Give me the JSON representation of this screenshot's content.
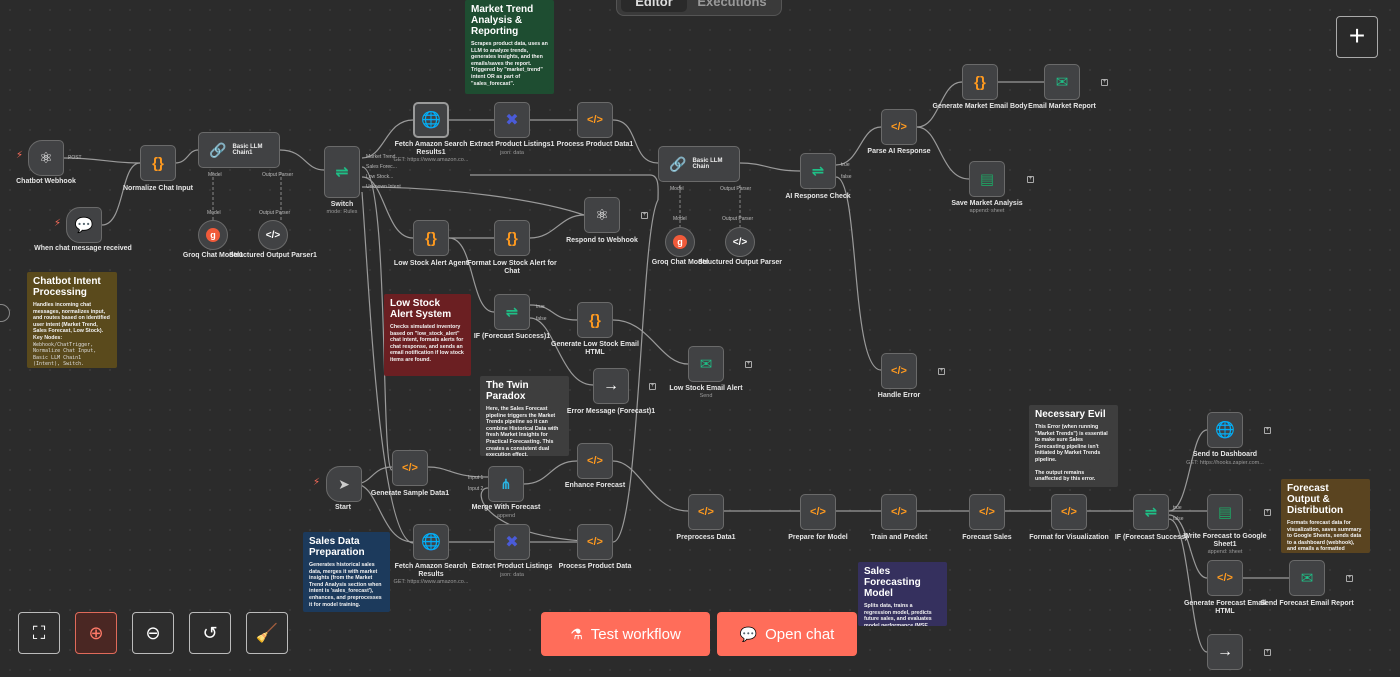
{
  "header": {
    "tabs": [
      "Editor",
      "Executions"
    ],
    "add_button": "+"
  },
  "colors": {
    "accent": "#ff6d5a",
    "canvas": "#2b2b2b",
    "node": "#414244"
  },
  "notes": [
    {
      "title": "Market Trend Analysis & Reporting",
      "body": "Scrapes product data, uses an LLM to analyze trends, generates insights, and then emails/saves the report. Triggered by \"market_trend\" intent OR as part of \"sales_forecast\".",
      "body2": "",
      "mono": ""
    },
    {
      "title": "Chatbot Intent Processing",
      "body": "Handles incoming chat messages, normalizes input, and routes based on identified user intent (Market Trend, Sales Forecast, Low Stock). Key Nodes:",
      "body2": "",
      "mono": "Webhook/ChatTrigger, Normalize Chat Input, Basic LLM Chain1 (Intent), Switch."
    },
    {
      "title": "Low Stock Alert System",
      "body": "Checks simulated inventory based on \"low_stock_alert\" chat intent, formats alerts for chat response, and sends an email notification if low stock items are found.",
      "body2": "",
      "mono": ""
    },
    {
      "title": "The Twin Paradox",
      "body": "Here, the Sales Forecast pipeline triggers the Market Trends pipeline so it can combine Historical Data with fresh Market Insights for Practical Forecasting. This creates a consistent dual execution effect.",
      "body2": "",
      "mono": ""
    },
    {
      "title": "Necessary Evil",
      "body": "This Error (when running \"Market Trends\") is essential to make sure Sales Forecasting pipeline isn't initiated by Market Trends pipeline.",
      "body2": "The output remains unaffected by this error.",
      "mono": ""
    },
    {
      "title": "Sales Data Preparation",
      "body": "Generates historical sales data, merges it with market insights (from the Market Trend Analysis section when intent is 'sales_forecast'), enhances, and preprocesses it for model training.",
      "body2": "",
      "mono": ""
    },
    {
      "title": "Sales Forecasting Model",
      "body": "Splits data, trains a regression model, predicts future sales, and evaluates model performance (MSE, RMSE, R²).",
      "body2": "",
      "mono": ""
    },
    {
      "title": "Forecast Output & Distribution",
      "body": "Formats forecast data for visualization, saves summary to Google Sheets, sends data to a dashboard (webhook), and emails a formatted forecast report.",
      "body2": "",
      "mono": ""
    }
  ],
  "nodes": [
    {
      "label": "Chatbot Webhook",
      "sub": ""
    },
    {
      "label": "When chat message received",
      "sub": ""
    },
    {
      "label": "Normalize Chat Input",
      "sub": ""
    },
    {
      "label": "Basic LLM Chain1",
      "sub": ""
    },
    {
      "label": "Groq Chat Model1",
      "sub": ""
    },
    {
      "label": "Structured Output Parser1",
      "sub": ""
    },
    {
      "label": "Switch",
      "sub": "mode: Rules"
    },
    {
      "label": "Fetch Amazon Search Results1",
      "sub": "GET: https://www.amazon.co..."
    },
    {
      "label": "Extract Product Listings1",
      "sub": "json: data"
    },
    {
      "label": "Process Product Data1",
      "sub": ""
    },
    {
      "label": "Basic LLM Chain",
      "sub": ""
    },
    {
      "label": "Groq Chat Model",
      "sub": ""
    },
    {
      "label": "Structured Output Parser",
      "sub": ""
    },
    {
      "label": "AI Response Check",
      "sub": ""
    },
    {
      "label": "Parse AI Response",
      "sub": ""
    },
    {
      "label": "Generate Market Email Body",
      "sub": ""
    },
    {
      "label": "Email Market Report",
      "sub": ""
    },
    {
      "label": "Save Market Analysis",
      "sub": "append: sheet"
    },
    {
      "label": "Respond to Webhook",
      "sub": ""
    },
    {
      "label": "Low Stock Alert Agent",
      "sub": ""
    },
    {
      "label": "Format Low Stock Alert for Chat",
      "sub": ""
    },
    {
      "label": "IF (Forecast Success)1",
      "sub": ""
    },
    {
      "label": "Generate Low Stock Email HTML",
      "sub": ""
    },
    {
      "label": "Low Stock Email Alert",
      "sub": "Send"
    },
    {
      "label": "Error Message (Forecast)1",
      "sub": ""
    },
    {
      "label": "Handle Error",
      "sub": ""
    },
    {
      "label": "Start",
      "sub": ""
    },
    {
      "label": "Generate Sample Data1",
      "sub": ""
    },
    {
      "label": "Merge With Forecast",
      "sub": "append"
    },
    {
      "label": "Enhance Forecast",
      "sub": ""
    },
    {
      "label": "Fetch Amazon Search Results",
      "sub": "GET: https://www.amazon.co..."
    },
    {
      "label": "Extract Product Listings",
      "sub": "json: data"
    },
    {
      "label": "Process Product Data",
      "sub": ""
    },
    {
      "label": "Preprocess Data1",
      "sub": ""
    },
    {
      "label": "Prepare for Model",
      "sub": ""
    },
    {
      "label": "Train and Predict",
      "sub": ""
    },
    {
      "label": "Forecast Sales",
      "sub": ""
    },
    {
      "label": "Format for Visualization",
      "sub": ""
    },
    {
      "label": "IF (Forecast Success)",
      "sub": ""
    },
    {
      "label": "Send to Dashboard",
      "sub": "GET: https://hooks.zapier.com..."
    },
    {
      "label": "Write Forecast to Google Sheet1",
      "sub": "append: sheet"
    },
    {
      "label": "Generate Forecast Email HTML",
      "sub": ""
    },
    {
      "label": "Send Forecast Email Report",
      "sub": ""
    }
  ],
  "ports": {
    "post": "POST",
    "model": "Model",
    "output_parser": "Output Parser",
    "true": "true",
    "false": "false",
    "input1": "Input 1",
    "input2": "Input 2",
    "switch_outputs": [
      "Market Trend",
      "Sales Forec...",
      "Low Stock...",
      "Unknown Intent"
    ]
  },
  "buttons": {
    "test_workflow": "Test workflow",
    "open_chat": "Open chat"
  }
}
